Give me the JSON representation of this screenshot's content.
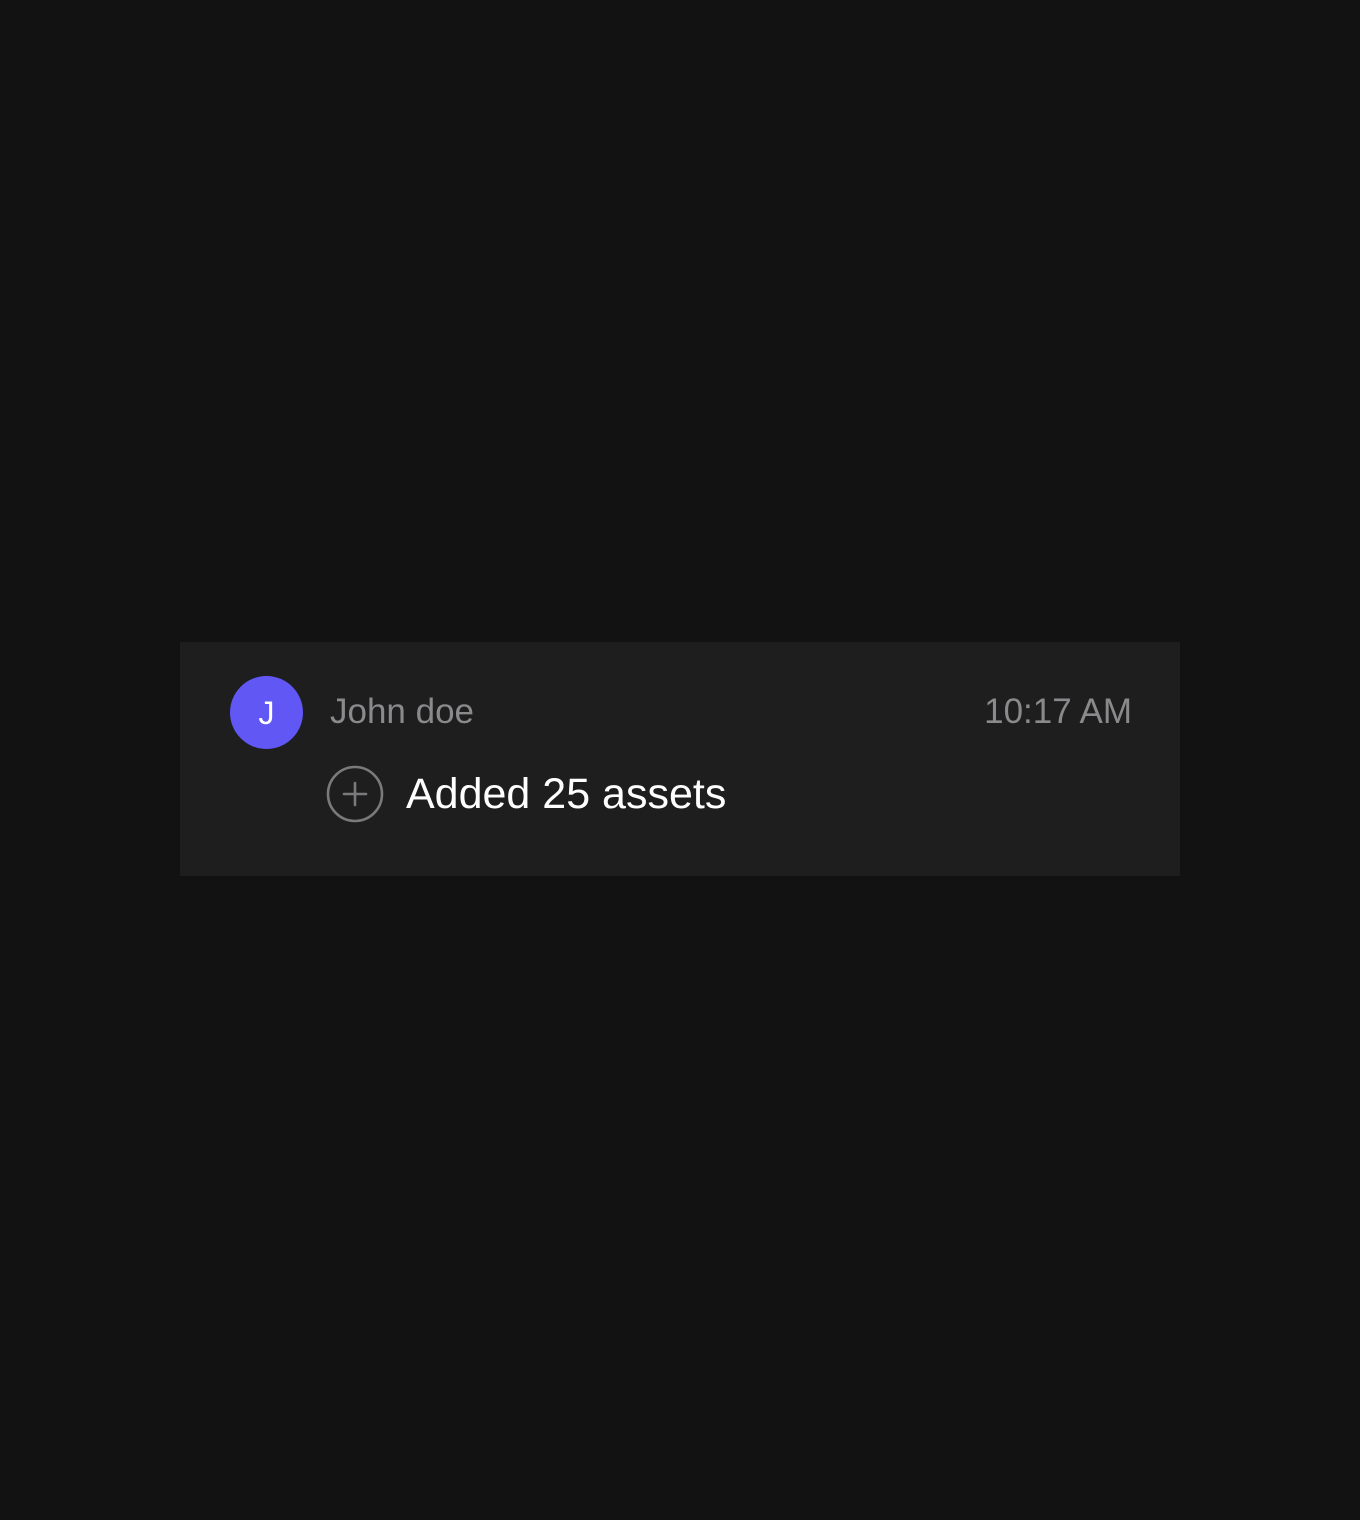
{
  "activity": {
    "user": {
      "initial": "J",
      "name": "John doe",
      "avatar_color": "#6157f5"
    },
    "timestamp": "10:17 AM",
    "action": {
      "icon": "plus-circle-icon",
      "text": "Added 25 assets"
    }
  },
  "colors": {
    "background": "#121212",
    "card": "#1e1e1f",
    "muted_text": "#8a8a8c",
    "primary_text": "#ffffff",
    "icon_stroke": "#7a7a7c"
  }
}
